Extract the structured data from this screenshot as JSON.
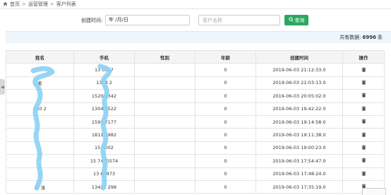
{
  "breadcrumb": {
    "home": "首页",
    "section": "运营管理",
    "current": "客户列表",
    "separator": ">"
  },
  "filter": {
    "created_label": "创建时间:",
    "date_value": "年 /月/日",
    "name_placeholder": "客户名称",
    "search_label": "查询"
  },
  "summary": {
    "prefix": "共有数据:",
    "count": "6996",
    "suffix": "条"
  },
  "table": {
    "columns": [
      "姓名",
      "手机",
      "性别",
      "年龄",
      "创建时间",
      "操作"
    ],
    "rows": [
      {
        "name": "",
        "phone": "13  0527",
        "gender": "",
        "age": "0",
        "created": "2019-06-03 21:12:33.0"
      },
      {
        "name": "麦",
        "phone": "1318  2",
        "gender": "",
        "age": "0",
        "created": "2019-06-03 21:03:13.0"
      },
      {
        "name": "",
        "phone": "1520  8342",
        "gender": "",
        "age": "0",
        "created": "2019-06-03 20:05:02.0"
      },
      {
        "name": "130  2",
        "phone": "1304  0522",
        "gender": "",
        "age": "0",
        "created": "2019-06-03 19:42:22.0"
      },
      {
        "name": "",
        "phone": "1590  7177",
        "gender": "",
        "age": "0",
        "created": "2019-06-03 19:14:58.0"
      },
      {
        "name": "",
        "phone": "1811  1982",
        "gender": "",
        "age": "0",
        "created": "2019-06-03 19:11:38.0"
      },
      {
        "name": "",
        "phone": "15  6002",
        "gender": "",
        "age": "0",
        "created": "2019-06-03 19:00:23.0"
      },
      {
        "name": "",
        "phone": "15  7430574",
        "gender": "",
        "age": "0",
        "created": "2019-06-03 17:54:47.0"
      },
      {
        "name": "",
        "phone": "13  66973",
        "gender": "",
        "age": "0",
        "created": "2019-06-03 17:48:24.0"
      },
      {
        "name": "李  涛",
        "phone": "13481  298",
        "gender": "",
        "age": "0",
        "created": "2019-06-03 17:35:19.0"
      }
    ]
  },
  "icons": {
    "home": "home-icon",
    "search": "search-icon",
    "delete": "trash-icon"
  },
  "colors": {
    "search_button": "#2aa861",
    "summary_bar": "#eef5fb",
    "redaction": "#8fd3f4"
  }
}
